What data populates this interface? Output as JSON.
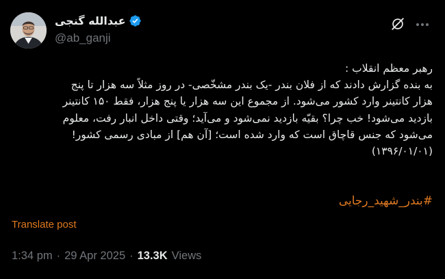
{
  "author": {
    "display_name": "عبدالله گنجی",
    "handle": "@ab_ganji",
    "verified_badge_color": "#1d9bf0"
  },
  "tweet": {
    "lines": [
      "رهبر معظم انقلاب :",
      "به بنده گزارش دادند که از فلان بندر -یک بندر مشخّصی- در روز مثلاً سه هزار تا پنج",
      "هزار کانتینر وارد کشور می‌شود. از مجموع این سه هزار یا پنج هزار، فقط ۱۵۰ کانتینر",
      "بازدید می‌شود! خب چرا؟ بقیّه بازدید نمی‌شود و می‌آید؛ وقتی داخل انبار رفت، معلوم",
      "می‌شود که جنس قاچاق است که وارد شده است؛ [آن هم] از مبادی رسمی کشور!",
      "(۱۳۹۶/۰۱/۰۱)"
    ],
    "hashtag": "#بندر_شهید_رجایی"
  },
  "actions": {
    "translate_label": "Translate post"
  },
  "meta": {
    "time": "1:34 pm",
    "separator": "·",
    "date": "29 Apr 2025",
    "views_count": "13.3K",
    "views_label": "Views"
  },
  "colors": {
    "background": "#000000",
    "text_primary": "#e7e9ea",
    "text_secondary": "#71767b",
    "accent": "#e07a22"
  }
}
